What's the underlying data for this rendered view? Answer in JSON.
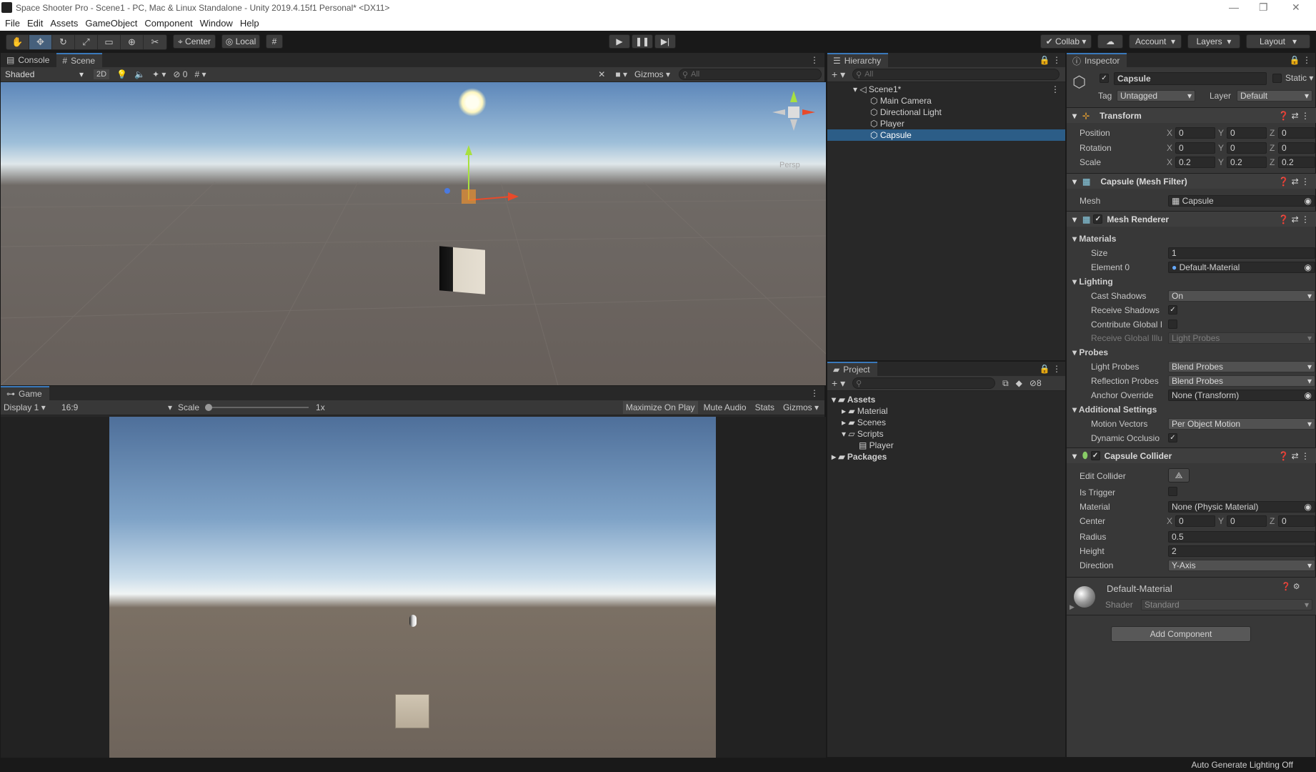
{
  "window": {
    "title": "Space Shooter Pro - Scene1 - PC, Mac & Linux Standalone - Unity 2019.4.15f1 Personal* <DX11>"
  },
  "menu": [
    "File",
    "Edit",
    "Assets",
    "GameObject",
    "Component",
    "Window",
    "Help"
  ],
  "toolbar": {
    "pivot": "Center",
    "space": "Local",
    "collab": "Collab",
    "account": "Account",
    "layers": "Layers",
    "layout": "Layout"
  },
  "scene_panel": {
    "tab_console": "Console",
    "tab_scene": "Scene",
    "shading": "Shaded",
    "mode2d": "2D",
    "hidden_count": "0",
    "gizmos": "Gizmos",
    "search_placeholder": "All",
    "persp": "Persp"
  },
  "game_panel": {
    "tab": "Game",
    "display": "Display 1",
    "aspect": "16:9",
    "scale_label": "Scale",
    "scale_value": "1x",
    "maximize": "Maximize On Play",
    "mute": "Mute Audio",
    "stats": "Stats",
    "gizmos": "Gizmos"
  },
  "hierarchy": {
    "tab": "Hierarchy",
    "search_placeholder": "All",
    "scene": "Scene1*",
    "items": [
      "Main Camera",
      "Directional Light",
      "Player",
      "Capsule"
    ]
  },
  "project": {
    "tab": "Project",
    "hidden_count": "8",
    "root": "Assets",
    "folders": [
      "Material",
      "Scenes",
      "Scripts"
    ],
    "script": "Player",
    "packages": "Packages"
  },
  "inspector": {
    "tab": "Inspector",
    "object_name": "Capsule",
    "static_label": "Static",
    "tag_label": "Tag",
    "tag_value": "Untagged",
    "layer_label": "Layer",
    "layer_value": "Default",
    "transform": {
      "title": "Transform",
      "position": {
        "label": "Position",
        "x": "0",
        "y": "0",
        "z": "0"
      },
      "rotation": {
        "label": "Rotation",
        "x": "0",
        "y": "0",
        "z": "0"
      },
      "scale": {
        "label": "Scale",
        "x": "0.2",
        "y": "0.2",
        "z": "0.2"
      }
    },
    "mesh_filter": {
      "title": "Capsule (Mesh Filter)",
      "mesh_label": "Mesh",
      "mesh_value": "Capsule"
    },
    "mesh_renderer": {
      "title": "Mesh Renderer",
      "materials": "Materials",
      "size_label": "Size",
      "size_value": "1",
      "element_label": "Element 0",
      "element_value": "Default-Material",
      "lighting": "Lighting",
      "cast_label": "Cast Shadows",
      "cast_value": "On",
      "receive_label": "Receive Shadows",
      "contribute_label": "Contribute Global I",
      "receive_gi_label": "Receive Global Illu",
      "receive_gi_value": "Light Probes",
      "probes": "Probes",
      "light_probes_label": "Light Probes",
      "light_probes_value": "Blend Probes",
      "refl_label": "Reflection Probes",
      "refl_value": "Blend Probes",
      "anchor_label": "Anchor Override",
      "anchor_value": "None (Transform)",
      "additional": "Additional Settings",
      "motion_label": "Motion Vectors",
      "motion_value": "Per Object Motion",
      "dynamic_label": "Dynamic Occlusio"
    },
    "collider": {
      "title": "Capsule Collider",
      "edit_label": "Edit Collider",
      "trigger_label": "Is Trigger",
      "material_label": "Material",
      "material_value": "None (Physic Material)",
      "center_label": "Center",
      "cx": "0",
      "cy": "0",
      "cz": "0",
      "radius_label": "Radius",
      "radius_value": "0.5",
      "height_label": "Height",
      "height_value": "2",
      "direction_label": "Direction",
      "direction_value": "Y-Axis"
    },
    "material": {
      "name": "Default-Material",
      "shader_label": "Shader",
      "shader_value": "Standard"
    },
    "add_component": "Add Component"
  },
  "status": {
    "text": "Auto Generate Lighting Off"
  },
  "axis_labels": {
    "x": "X",
    "y": "Y",
    "z": "Z"
  }
}
